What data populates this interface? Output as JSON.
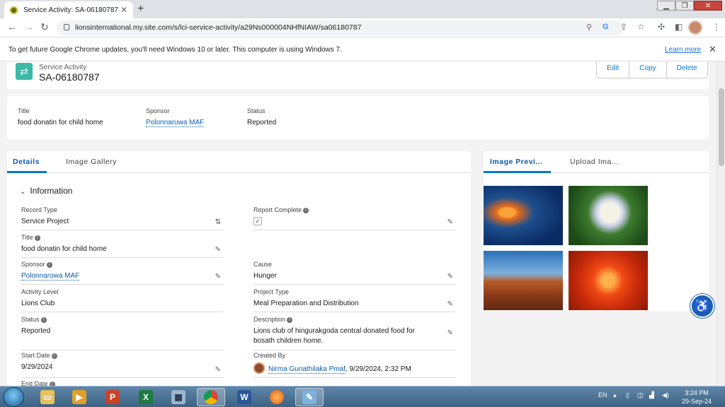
{
  "browser": {
    "tab_title": "Service Activity: SA-06180787",
    "url": "lionsinternational.my.site.com/s/lci-service-activity/a29Ns000004NHfNIAW/sa06180787",
    "infobar_message": "To get future Google Chrome updates, you'll need Windows 10 or later. This computer is using Windows 7.",
    "infobar_link": "Learn more"
  },
  "record": {
    "object_label": "Service Activity",
    "name": "SA-06180787",
    "actions": [
      "Edit",
      "Copy",
      "Delete"
    ]
  },
  "highlights": [
    {
      "label": "Title",
      "value": "food donatin for child home"
    },
    {
      "label": "Sponsor",
      "value": "Polonnaruwa MAF"
    },
    {
      "label": "Status",
      "value": "Reported"
    }
  ],
  "tabs": {
    "details": "Details",
    "gallery": "Image Gallery"
  },
  "section": {
    "title": "Information"
  },
  "fields_left": [
    {
      "label": "Record Type",
      "value": "Service Project"
    },
    {
      "label": "Title",
      "value": "food donatin for child home"
    },
    {
      "label": "Sponsor",
      "value": "Polonnaruwa MAF"
    },
    {
      "label": "Activity Level",
      "value": "Lions Club"
    },
    {
      "label": "Status",
      "value": "Reported"
    },
    {
      "label": "Start Date",
      "value": "9/29/2024"
    },
    {
      "label": "End Date",
      "value": ""
    }
  ],
  "fields_right": [
    {
      "label": "Report Complete",
      "value": ""
    },
    {
      "label": "Cause",
      "value": "Hunger"
    },
    {
      "label": "Project Type",
      "value": "Meal Preparation and Distribution"
    },
    {
      "label": "Description",
      "value": "Lions club of hingurakgoda central donated food for bosath children home."
    },
    {
      "label": "Created By",
      "user": "Nirma Gunathilaka Pmaf",
      "value": ", 9/29/2024, 2:32 PM"
    }
  ],
  "side_tabs": {
    "preview": "Image Previ...",
    "upload": "Upload Ima..."
  },
  "taskbar": {
    "lang": "EN",
    "time": "3:24 PM",
    "date": "29-Sep-24"
  },
  "colors": {
    "accent": "#0176d3",
    "object_icon": "#3ab8a8"
  }
}
